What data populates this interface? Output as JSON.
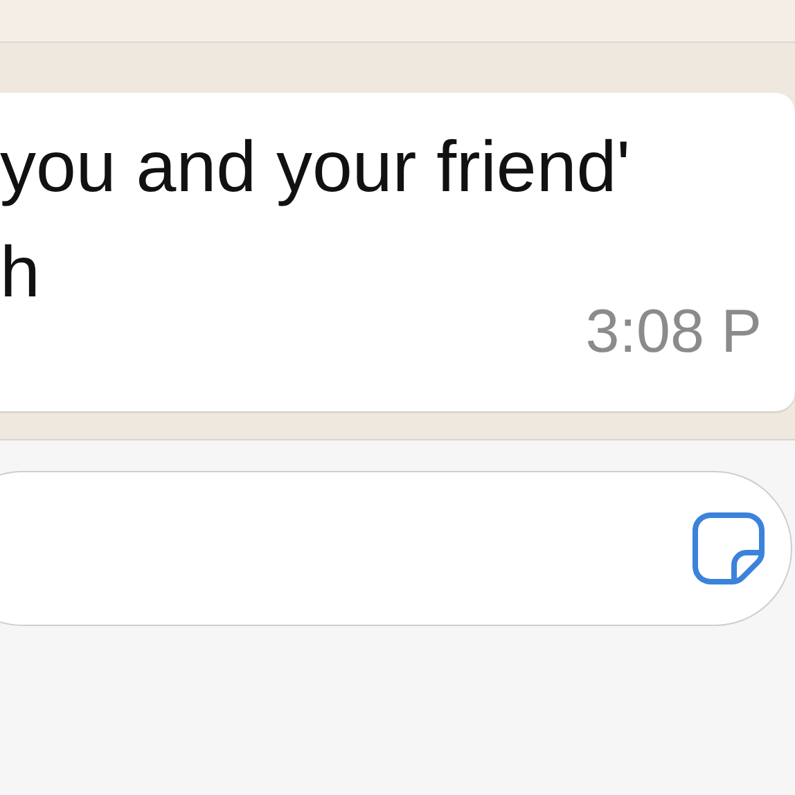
{
  "message": {
    "lines": [
      "you and your friend'",
      "h"
    ],
    "time": "3:08 P"
  }
}
